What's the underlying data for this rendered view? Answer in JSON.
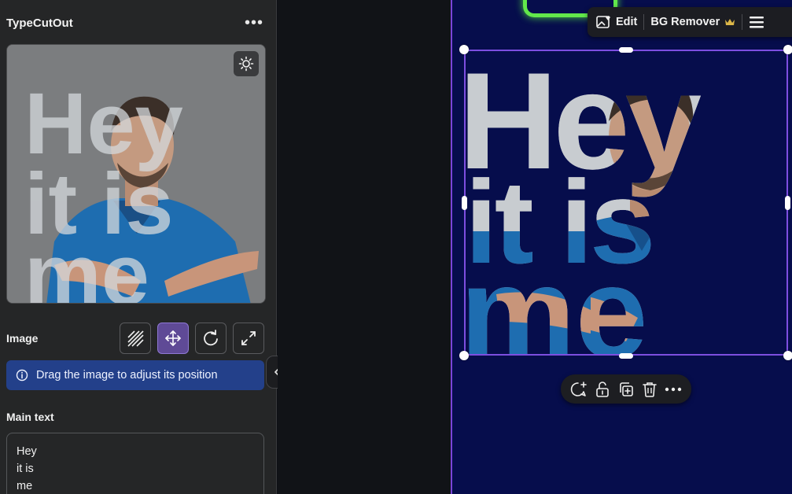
{
  "panel": {
    "title": "TypeCutOut",
    "more_label": "•••"
  },
  "image_section": {
    "label": "Image",
    "tools": [
      "pattern-icon",
      "move-icon",
      "rotate-icon",
      "expand-icon"
    ],
    "active_tool": "move-icon"
  },
  "info": {
    "text": "Drag the image to adjust its position"
  },
  "main_text": {
    "label": "Main text",
    "lines": [
      "Hey",
      "it is",
      "me"
    ]
  },
  "design": {
    "words": [
      "Hey",
      "it is",
      "me"
    ]
  },
  "top_toolbar": {
    "edit_label": "Edit",
    "bg_remover_label": "BG Remover"
  },
  "colors": {
    "panel_bg": "#252627",
    "canvas_page": "#060d4c",
    "accent_purple": "#7d4ee0",
    "info_blue": "#23408a",
    "letters_gray": "#c8ccd0"
  }
}
